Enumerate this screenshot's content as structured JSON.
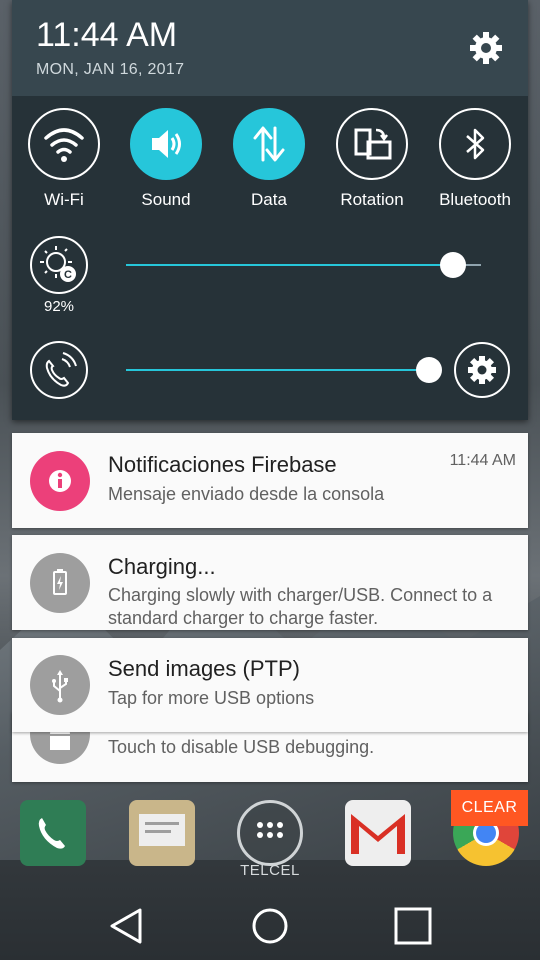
{
  "status": {
    "time": "11:44 AM",
    "date": "MON, JAN 16, 2017"
  },
  "quick_settings": {
    "tiles": [
      {
        "label": "Wi-Fi",
        "icon": "wifi-icon",
        "active": false
      },
      {
        "label": "Sound",
        "icon": "volume-icon",
        "active": true
      },
      {
        "label": "Data",
        "icon": "data-arrows-icon",
        "active": true
      },
      {
        "label": "Rotation",
        "icon": "rotation-icon",
        "active": false
      },
      {
        "label": "Bluetooth",
        "icon": "bluetooth-icon",
        "active": false
      }
    ],
    "brightness": {
      "label": "92%",
      "level": 0.92
    },
    "volume": {
      "level": 0.87
    },
    "accent_color": "#26c6da"
  },
  "notifications": [
    {
      "title": "Notificaciones Firebase",
      "text": "Mensaje enviado desde la consola",
      "time": "11:44 AM",
      "icon": "info-icon",
      "icon_color": "#ec407a"
    },
    {
      "title": "Charging...",
      "text": "Charging slowly with charger/USB. Connect to a standard charger to charge faster.",
      "icon": "battery-icon",
      "icon_color": "#9e9e9e"
    },
    {
      "title": "Send images (PTP)",
      "text": "Tap for more USB options",
      "icon": "usb-icon",
      "icon_color": "#9e9e9e"
    },
    {
      "text": "Touch to disable USB debugging.",
      "icon": "android-icon",
      "icon_color": "#9e9e9e"
    }
  ],
  "clear_label": "CLEAR",
  "dock": {
    "carrier_label": "TELCEL"
  }
}
